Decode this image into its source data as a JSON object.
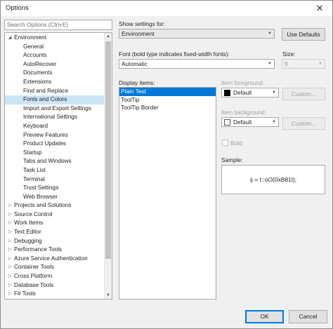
{
  "window": {
    "title": "Options",
    "close_glyph": "✕"
  },
  "search": {
    "placeholder": "Search Options (Ctrl+E)"
  },
  "tree": {
    "items": [
      {
        "label": "Environment",
        "level": 0,
        "expanded": true
      },
      {
        "label": "General",
        "level": 1
      },
      {
        "label": "Accounts",
        "level": 1
      },
      {
        "label": "AutoRecover",
        "level": 1
      },
      {
        "label": "Documents",
        "level": 1
      },
      {
        "label": "Extensions",
        "level": 1
      },
      {
        "label": "Find and Replace",
        "level": 1
      },
      {
        "label": "Fonts and Colors",
        "level": 1,
        "selected": true
      },
      {
        "label": "Import and Export Settings",
        "level": 1
      },
      {
        "label": "International Settings",
        "level": 1
      },
      {
        "label": "Keyboard",
        "level": 1
      },
      {
        "label": "Preview Features",
        "level": 1
      },
      {
        "label": "Product Updates",
        "level": 1
      },
      {
        "label": "Startup",
        "level": 1
      },
      {
        "label": "Tabs and Windows",
        "level": 1
      },
      {
        "label": "Task List",
        "level": 1
      },
      {
        "label": "Terminal",
        "level": 1
      },
      {
        "label": "Trust Settings",
        "level": 1
      },
      {
        "label": "Web Browser",
        "level": 1
      },
      {
        "label": "Projects and Solutions",
        "level": 0
      },
      {
        "label": "Source Control",
        "level": 0
      },
      {
        "label": "Work Items",
        "level": 0
      },
      {
        "label": "Text Editor",
        "level": 0
      },
      {
        "label": "Debugging",
        "level": 0
      },
      {
        "label": "Performance Tools",
        "level": 0
      },
      {
        "label": "Azure Service Authentication",
        "level": 0
      },
      {
        "label": "Container Tools",
        "level": 0
      },
      {
        "label": "Cross Platform",
        "level": 0
      },
      {
        "label": "Database Tools",
        "level": 0
      },
      {
        "label": "F# Tools",
        "level": 0
      }
    ]
  },
  "settings": {
    "show_settings_label": "Show settings for:",
    "show_settings_value": "Environment",
    "use_defaults_label": "Use Defaults",
    "font_label": "Font (bold type indicates fixed-width fonts):",
    "font_value": "Automatic",
    "size_label": "Size:",
    "size_value": "9",
    "display_items_label": "Display items:",
    "display_items": [
      "Plain Text",
      "ToolTip",
      "ToolTip Border"
    ],
    "item_foreground_label": "Item foreground:",
    "item_foreground_value": "Default",
    "item_background_label": "Item background:",
    "item_background_value": "Default",
    "custom_label": "Custom...",
    "bold_label": "Bold",
    "sample_label": "Sample:",
    "sample_text": "ij = I::oO(0xB81l);"
  },
  "footer": {
    "ok_label": "OK",
    "cancel_label": "Cancel"
  },
  "icons": {
    "expand": "chevron-right-icon",
    "collapse": "chevron-down-icon",
    "dropdown": "dropdown-arrow-icon"
  },
  "colors": {
    "selection": "#0078d7",
    "tree_selection": "#cce4f7"
  }
}
